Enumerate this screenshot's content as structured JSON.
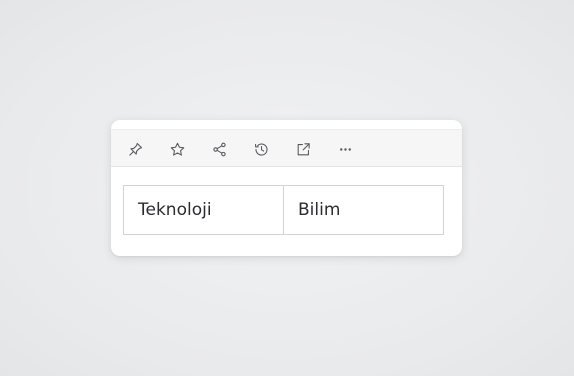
{
  "toolbar": {
    "buttons": [
      {
        "icon": "pin-icon"
      },
      {
        "icon": "star-icon"
      },
      {
        "icon": "share-icon"
      },
      {
        "icon": "history-icon"
      },
      {
        "icon": "external-link-icon"
      },
      {
        "icon": "more-icon"
      }
    ]
  },
  "table": {
    "cells": [
      "Teknoloji",
      "Bilim"
    ]
  }
}
